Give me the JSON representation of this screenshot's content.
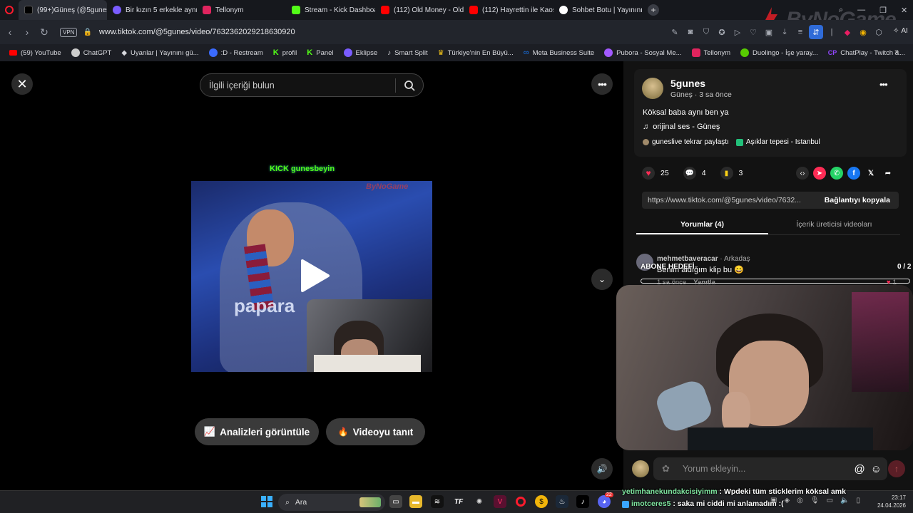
{
  "browser": {
    "tabs": [
      {
        "label": "(99+)Güneş (@5gunes) | T",
        "color": "#000000",
        "active": true
      },
      {
        "label": "Bir kızın 5 erkekle aynı anda",
        "color": "#7a5cff",
        "active": false
      },
      {
        "label": "Tellonym",
        "color": "#e0245e",
        "active": false
      },
      {
        "label": "Stream - Kick Dashboard",
        "color": "#53fc18",
        "active": false
      },
      {
        "label": "(112) Old Money - Old",
        "color": "#ff0000",
        "active": false
      },
      {
        "label": "(112) Hayrettin ile Kaos Sh",
        "color": "#ff0000",
        "active": false
      },
      {
        "label": "Sohbet Botu | Yayınını güç",
        "color": "#ffffff",
        "active": false
      }
    ],
    "url": "www.tiktok.com/@5gunes/video/7632362029218630920",
    "vpn_label": "VPN",
    "ai_label": "AI",
    "bookmarks": [
      {
        "label": "(59) YouTube",
        "color": "#ff0000"
      },
      {
        "label": "ChatGPT",
        "color": "#cccccc"
      },
      {
        "label": "Uyanlar | Yayınını gü...",
        "color": "#ffffff"
      },
      {
        "label": ":D - Restream",
        "color": "#3b6bff"
      },
      {
        "label": "profil",
        "color": "#53fc18"
      },
      {
        "label": "Panel",
        "color": "#53fc18"
      },
      {
        "label": "Eklipse",
        "color": "#7a5cff"
      },
      {
        "label": "Smart Split",
        "color": "#ffffff"
      },
      {
        "label": "Türkiye'nin En Büyü...",
        "color": "#f5c518"
      },
      {
        "label": "Meta Business Suite",
        "color": "#1877f2"
      },
      {
        "label": "Pubora - Sosyal Me...",
        "color": "#a259ff"
      },
      {
        "label": "Tellonym",
        "color": "#e0245e"
      },
      {
        "label": "Duolingo - İşe yaray...",
        "color": "#58cc02"
      },
      {
        "label": "ChatPlay - Twitch &...",
        "color": "#9146ff"
      }
    ]
  },
  "watermark": "ByNoGame",
  "video_area": {
    "search_placeholder": "İlgili içeriği bulun",
    "overlay_text": "KICK gunesbeyin",
    "small_watermark": "ByNoGame",
    "analytics_label": "Analizleri görüntüle",
    "promote_label": "Videoyu tanıt",
    "jersey_text": "papara"
  },
  "post": {
    "username": "5gunes",
    "subline": "Güneş · 3 sa önce",
    "caption": "Köksal baba aynı ben ya",
    "music": "orijinal ses - Güneş",
    "repost_label": "guneslive tekrar paylaştı",
    "location_label": "Aşıklar tepesi - Istanbul",
    "likes": "25",
    "comments": "4",
    "saves": "3",
    "link": "https://www.tiktok.com/@5gunes/video/7632...",
    "copy_link_label": "Bağlantıyı kopyala",
    "tabs": [
      {
        "label": "Yorumlar (4)",
        "active": true
      },
      {
        "label": "İçerik üreticisi videoları",
        "active": false
      }
    ],
    "comment": {
      "author": "mehmetbaveracar",
      "relation": " · Arkadaş",
      "text": "Benim aldığım klip bu 😄",
      "time": "1 sa önce",
      "reply_label": "Yanıtla",
      "like_count": "1"
    },
    "add_comment_placeholder": "Yorum ekleyin...",
    "goal": {
      "label": "ABONE HEDEFİ",
      "progress_text": "0 / 2"
    }
  },
  "chat_overlay": [
    {
      "user": "yetimhanekundakcisiyimm",
      "message": " : Wpdeki tüm sticklerim köksal amk",
      "color": "#7fe6a0"
    },
    {
      "user": "imotceres5",
      "message": " : saka mi ciddi mi anlamadım :(",
      "color": "#7fe6a0"
    }
  ],
  "taskbar": {
    "search_label": "Ara",
    "time": "23:17",
    "date": "24.04.2026",
    "badge_count": "22"
  }
}
